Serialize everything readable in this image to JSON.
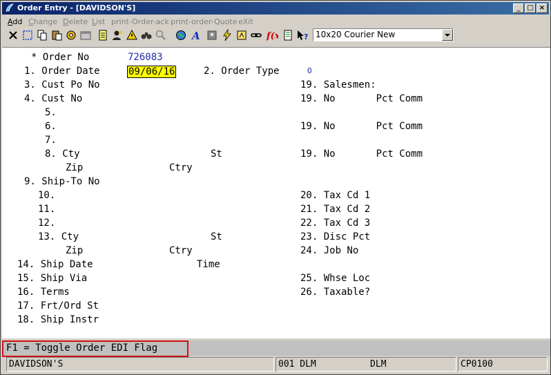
{
  "window": {
    "title": "Order Entry - [DAVIDSON'S]"
  },
  "menu": [
    {
      "label": "Add",
      "u": "A",
      "rest": "dd",
      "enabled": true
    },
    {
      "label": "Change",
      "u": "C",
      "rest": "hange",
      "enabled": false
    },
    {
      "label": "Delete",
      "u": "D",
      "rest": "elete",
      "enabled": false
    },
    {
      "label": "List",
      "u": "L",
      "rest": "ist",
      "enabled": false
    },
    {
      "label": "print-Order-ack",
      "u": "",
      "rest": "print-Order-ack",
      "enabled": false
    },
    {
      "label": "print-order-Quote",
      "u": "",
      "rest": "print-order-Quote",
      "enabled": false
    },
    {
      "label": "eXit",
      "u": "",
      "rest": "eXit",
      "enabled": false
    }
  ],
  "font_combo": {
    "value": "10x20 Courier New"
  },
  "form": {
    "order_no_label": "* Order No",
    "order_no_value": "726083",
    "order_date_label": "1. Order Date",
    "order_date_value": "09/06/16",
    "order_type_label": "2. Order Type",
    "order_type_value": "O",
    "cust_po_label": "3. Cust Po No",
    "cust_no_label": "4. Cust No",
    "l5": "5.",
    "l6": "6.",
    "l7": "7.",
    "l8": "8. Cty",
    "st1": "St",
    "zip1": "Zip",
    "ctry1": "Ctry",
    "shipto_label": "9. Ship-To No",
    "l10": "10.",
    "l11": "11.",
    "l12": "12.",
    "l13": "13. Cty",
    "st2": "St",
    "zip2": "Zip",
    "ctry2": "Ctry",
    "l14": "14. Ship Date",
    "time": "Time",
    "l15": "15. Ship Via",
    "l16": "16. Terms",
    "l17": "17. Frt/Ord St",
    "l18": "18. Ship Instr",
    "salesmen": "19. Salesmen:",
    "sm1": "19. No       Pct Comm",
    "sm2": "19. No       Pct Comm",
    "sm3": "19. No       Pct Comm",
    "l20": "20. Tax Cd 1",
    "l21": "21. Tax Cd 2",
    "l22": "22. Tax Cd 3",
    "l23": "23. Disc Pct",
    "l24": "24. Job No",
    "l25": "25. Whse Loc",
    "l26": "26. Taxable?"
  },
  "message": "F1 = Toggle Order EDI Flag",
  "status": {
    "company": "DAVIDSON'S",
    "user": "001 DLM          DLM",
    "program": "CP0100"
  }
}
